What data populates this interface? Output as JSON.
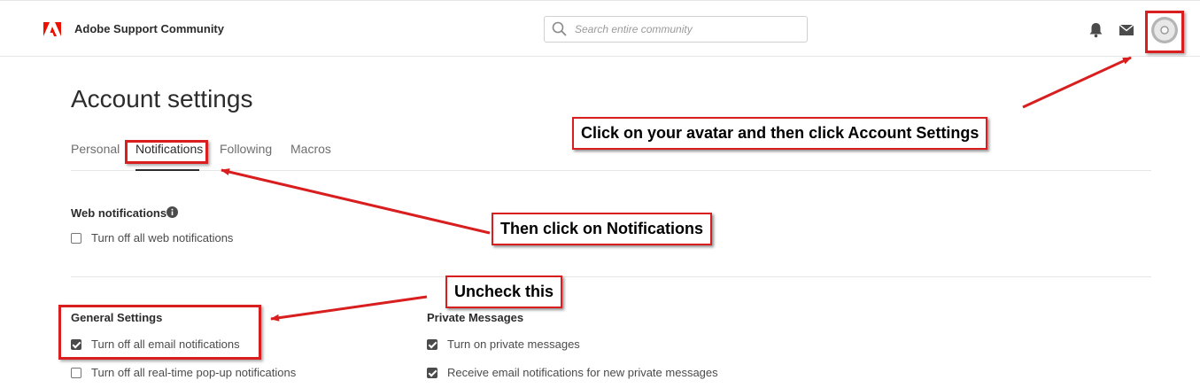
{
  "header": {
    "brand": "Adobe Support Community",
    "search_placeholder": "Search entire community",
    "logo_icon": "adobe-logo-icon",
    "accent_color": "#eb1000"
  },
  "page": {
    "title": "Account settings",
    "tabs": [
      {
        "label": "Personal",
        "active": false
      },
      {
        "label": "Notifications",
        "active": true
      },
      {
        "label": "Following",
        "active": false
      },
      {
        "label": "Macros",
        "active": false
      }
    ]
  },
  "web_notifications": {
    "title": "Web notifications",
    "options": [
      {
        "label": "Turn off all web notifications",
        "checked": false
      }
    ]
  },
  "general_settings": {
    "title": "General Settings",
    "options": [
      {
        "label": "Turn off all email notifications",
        "checked": true
      },
      {
        "label": "Turn off all real-time pop-up notifications",
        "checked": false
      }
    ]
  },
  "private_messages": {
    "title": "Private Messages",
    "options": [
      {
        "label": "Turn on private messages",
        "checked": true
      },
      {
        "label": "Receive email notifications for new private messages",
        "checked": true
      }
    ]
  },
  "annotations": {
    "avatar_callout": "Click on your avatar and then click Account Settings",
    "notifications_callout": "Then click on Notifications",
    "uncheck_callout": "Uncheck this",
    "annotation_color": "#d81e1e"
  }
}
